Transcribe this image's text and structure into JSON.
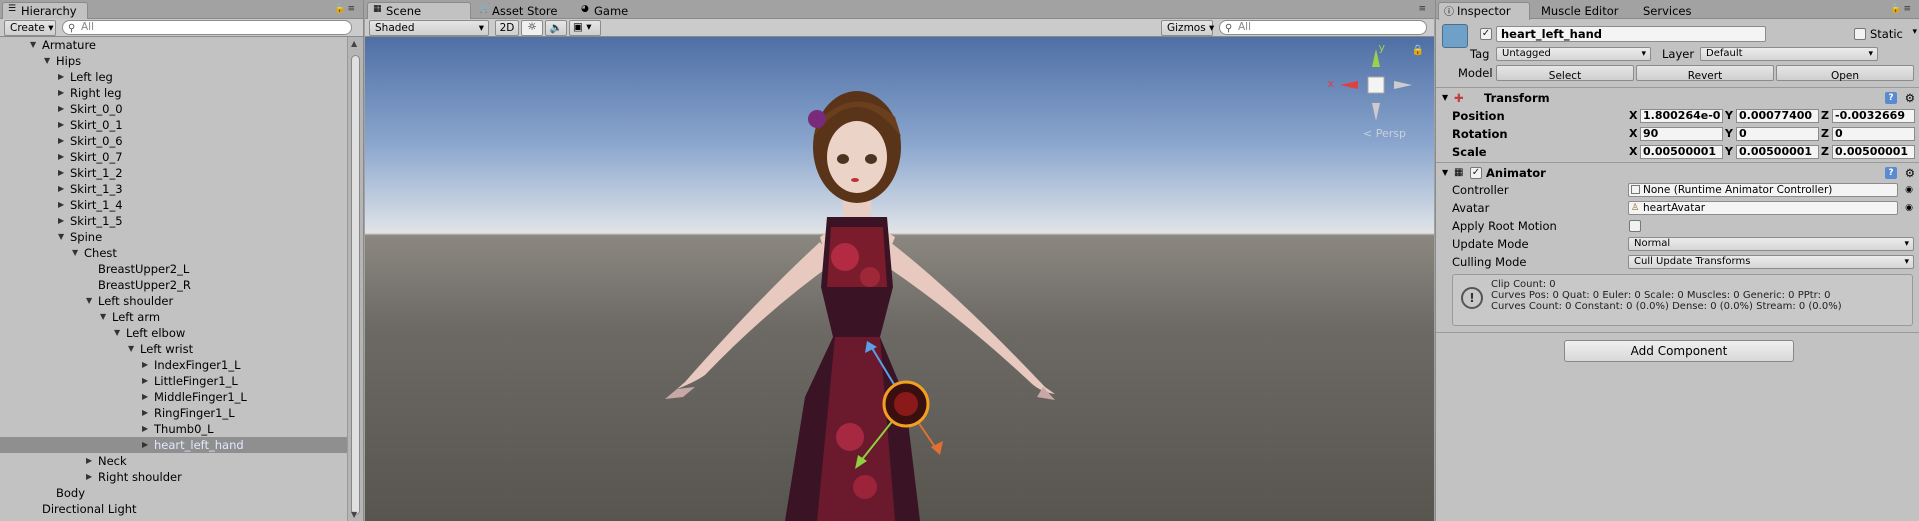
{
  "hierarchy": {
    "tab": "Hierarchy",
    "create_label": "Create",
    "search_placeholder": "All",
    "items": [
      {
        "label": "Armature",
        "indent": 0,
        "arrow": "open"
      },
      {
        "label": "Hips",
        "indent": 1,
        "arrow": "open"
      },
      {
        "label": "Left leg",
        "indent": 2,
        "arrow": "closed"
      },
      {
        "label": "Right leg",
        "indent": 2,
        "arrow": "closed"
      },
      {
        "label": "Skirt_0_0",
        "indent": 2,
        "arrow": "closed"
      },
      {
        "label": "Skirt_0_1",
        "indent": 2,
        "arrow": "closed"
      },
      {
        "label": "Skirt_0_6",
        "indent": 2,
        "arrow": "closed"
      },
      {
        "label": "Skirt_0_7",
        "indent": 2,
        "arrow": "closed"
      },
      {
        "label": "Skirt_1_2",
        "indent": 2,
        "arrow": "closed"
      },
      {
        "label": "Skirt_1_3",
        "indent": 2,
        "arrow": "closed"
      },
      {
        "label": "Skirt_1_4",
        "indent": 2,
        "arrow": "closed"
      },
      {
        "label": "Skirt_1_5",
        "indent": 2,
        "arrow": "closed"
      },
      {
        "label": "Spine",
        "indent": 2,
        "arrow": "open"
      },
      {
        "label": "Chest",
        "indent": 3,
        "arrow": "open"
      },
      {
        "label": "BreastUpper2_L",
        "indent": 4,
        "arrow": "none"
      },
      {
        "label": "BreastUpper2_R",
        "indent": 4,
        "arrow": "none"
      },
      {
        "label": "Left shoulder",
        "indent": 4,
        "arrow": "open"
      },
      {
        "label": "Left arm",
        "indent": 5,
        "arrow": "open"
      },
      {
        "label": "Left elbow",
        "indent": 6,
        "arrow": "open"
      },
      {
        "label": "Left wrist",
        "indent": 7,
        "arrow": "open"
      },
      {
        "label": "IndexFinger1_L",
        "indent": 8,
        "arrow": "closed"
      },
      {
        "label": "LittleFinger1_L",
        "indent": 8,
        "arrow": "closed"
      },
      {
        "label": "MiddleFinger1_L",
        "indent": 8,
        "arrow": "closed"
      },
      {
        "label": "RingFinger1_L",
        "indent": 8,
        "arrow": "closed"
      },
      {
        "label": "Thumb0_L",
        "indent": 8,
        "arrow": "closed"
      },
      {
        "label": "heart_left_hand",
        "indent": 8,
        "arrow": "closed",
        "selected": true
      },
      {
        "label": "Neck",
        "indent": 4,
        "arrow": "closed"
      },
      {
        "label": "Right shoulder",
        "indent": 4,
        "arrow": "closed"
      },
      {
        "label": "Body",
        "indent": 1,
        "arrow": "none"
      },
      {
        "label": "Directional Light",
        "indent": 0,
        "arrow": "none"
      }
    ]
  },
  "scene": {
    "tabs": [
      "Scene",
      "Asset Store",
      "Game"
    ],
    "shading_mode": "Shaded",
    "mode_2d": "2D",
    "gizmos_label": "Gizmos",
    "search_placeholder": "All",
    "view_label": "< Persp",
    "axis_x": "x",
    "axis_y": "y"
  },
  "inspector": {
    "tabs": [
      "Inspector",
      "Muscle Editor",
      "Services"
    ],
    "object_name": "heart_left_hand",
    "static_label": "Static",
    "tag_label": "Tag",
    "tag_value": "Untagged",
    "layer_label": "Layer",
    "layer_value": "Default",
    "model_label": "Model",
    "model_buttons": [
      "Select",
      "Revert",
      "Open"
    ],
    "transform": {
      "title": "Transform",
      "rows": [
        {
          "label": "Position",
          "x": "1.800264e-0",
          "y": "0.00077400",
          "z": "-0.0032669"
        },
        {
          "label": "Rotation",
          "x": "90",
          "y": "0",
          "z": "0"
        },
        {
          "label": "Scale",
          "x": "0.00500001",
          "y": "0.00500001",
          "z": "0.00500001"
        }
      ]
    },
    "animator": {
      "title": "Animator",
      "controller_label": "Controller",
      "controller_value": "None (Runtime Animator Controller)",
      "avatar_label": "Avatar",
      "avatar_value": "heartAvatar",
      "apply_root_motion_label": "Apply Root Motion",
      "update_mode_label": "Update Mode",
      "update_mode_value": "Normal",
      "culling_mode_label": "Culling Mode",
      "culling_mode_value": "Cull Update Transforms",
      "info_lines": [
        "Clip Count: 0",
        "Curves Pos: 0 Quat: 0 Euler: 0 Scale: 0 Muscles: 0 Generic: 0 PPtr: 0",
        "Curves Count: 0 Constant: 0 (0.0%) Dense: 0 (0.0%) Stream: 0 (0.0%)"
      ]
    },
    "add_component_label": "Add Component"
  }
}
